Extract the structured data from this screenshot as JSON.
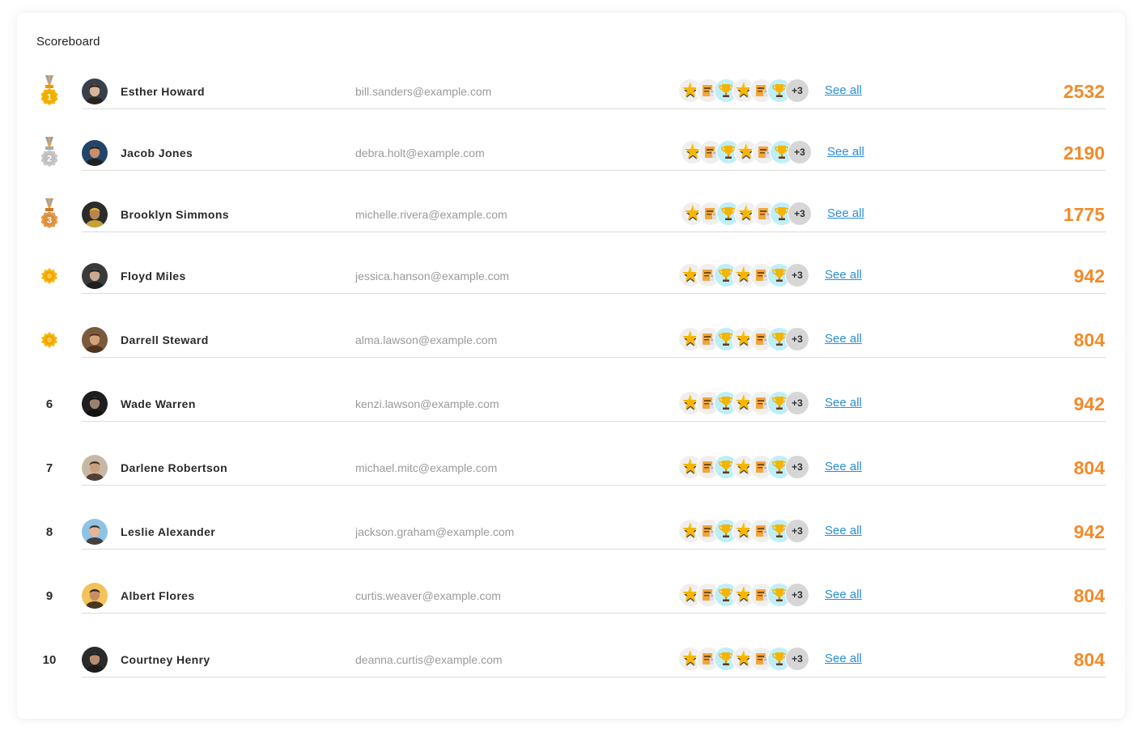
{
  "title": "Scoreboard",
  "accent_color": "#f28b2a",
  "link_color": "#2c8fd6",
  "badge_icons": [
    "star-icon",
    "notebook-icon",
    "trophy-icon",
    "star-icon",
    "notebook-icon",
    "trophy-icon"
  ],
  "see_all_label": "See all",
  "rows": [
    {
      "rank": "1",
      "rank_icon": "gold-medal-icon",
      "name": "Esther Howard",
      "email": "bill.sanders@example.com",
      "more_badges": "+3",
      "score": "2532"
    },
    {
      "rank": "2",
      "rank_icon": "silver-medal-icon",
      "name": "Jacob Jones",
      "email": "debra.holt@example.com",
      "more_badges": "+3",
      "score": "2190"
    },
    {
      "rank": "3",
      "rank_icon": "bronze-medal-icon",
      "name": "Brooklyn Simmons",
      "email": "michelle.rivera@example.com",
      "more_badges": "+3",
      "score": "1775"
    },
    {
      "rank": "",
      "rank_icon": "sun-badge-icon",
      "name": "Floyd Miles",
      "email": "jessica.hanson@example.com",
      "more_badges": "+3",
      "score": "942"
    },
    {
      "rank": "",
      "rank_icon": "sun-badge-icon",
      "name": "Darrell Steward",
      "email": "alma.lawson@example.com",
      "more_badges": "+3",
      "score": "804"
    },
    {
      "rank": "6",
      "rank_icon": "",
      "name": "Wade Warren",
      "email": "kenzi.lawson@example.com",
      "more_badges": "+3",
      "score": "942"
    },
    {
      "rank": "7",
      "rank_icon": "",
      "name": "Darlene Robertson",
      "email": "michael.mitc@example.com",
      "more_badges": "+3",
      "score": "804"
    },
    {
      "rank": "8",
      "rank_icon": "",
      "name": "Leslie Alexander",
      "email": "jackson.graham@example.com",
      "more_badges": "+3",
      "score": "942"
    },
    {
      "rank": "9",
      "rank_icon": "",
      "name": "Albert Flores",
      "email": "curtis.weaver@example.com",
      "more_badges": "+3",
      "score": "804"
    },
    {
      "rank": "10",
      "rank_icon": "",
      "name": "Courtney Henry",
      "email": "deanna.curtis@example.com",
      "more_badges": "+3",
      "score": "804"
    }
  ]
}
